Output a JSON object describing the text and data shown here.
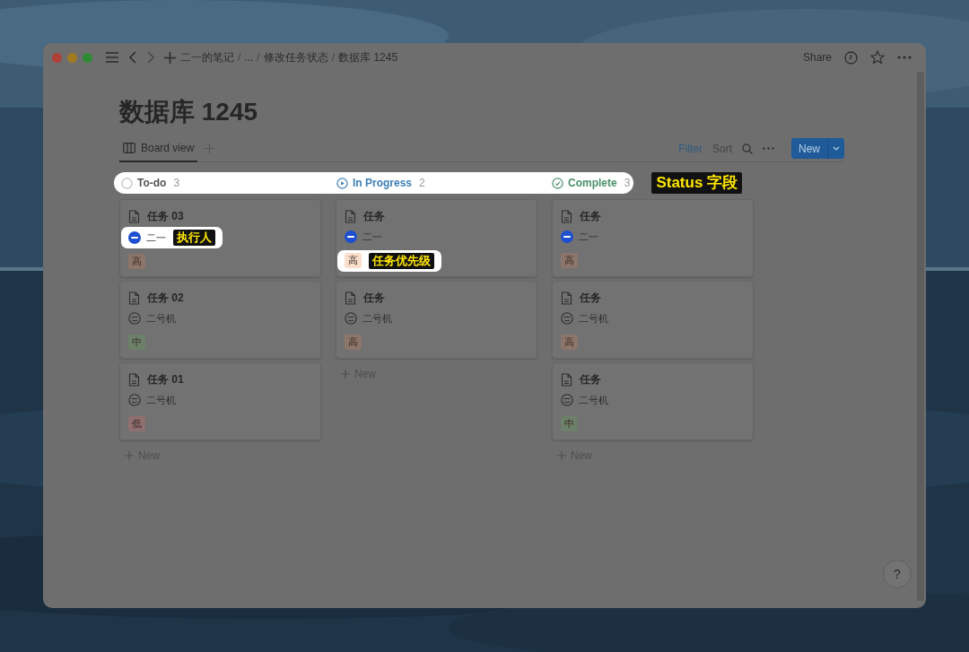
{
  "window": {
    "breadcrumbs": [
      "二一的笔记",
      "...",
      "修改任务状态",
      "数据库 1245"
    ],
    "separator": "/",
    "share": "Share",
    "help": "?"
  },
  "title": "数据库 1245",
  "views": [
    {
      "label": "Board view",
      "selected": true
    }
  ],
  "toolbar": {
    "filter": "Filter",
    "sort": "Sort",
    "new_button": "New"
  },
  "status_bar": {
    "highlighted": true,
    "annotation": "Status 字段"
  },
  "columns": [
    {
      "kind": "todo",
      "label": "To-do",
      "count": "3",
      "new_label": "New",
      "cards": [
        {
          "title": "任务 03",
          "assignee": {
            "kind": "avatar",
            "name": "二一",
            "highlighted": true,
            "annotation": "执行人"
          },
          "priority": {
            "label": "高",
            "color": "#8c766b",
            "highlighted": false
          }
        },
        {
          "title": "任务 02",
          "assignee": {
            "kind": "face",
            "name": "二号机",
            "highlighted": false
          },
          "priority": {
            "label": "中",
            "color": "#6d8069",
            "highlighted": false
          }
        },
        {
          "title": "任务 01",
          "assignee": {
            "kind": "face",
            "name": "二号机",
            "highlighted": false
          },
          "priority": {
            "label": "低",
            "color": "#8f6f6f",
            "highlighted": false
          }
        }
      ]
    },
    {
      "kind": "in_progress",
      "label": "In Progress",
      "count": "2",
      "new_label": "New",
      "cards": [
        {
          "title": "任务",
          "assignee": {
            "kind": "avatar",
            "name": "二一",
            "highlighted": false
          },
          "priority": {
            "label": "高",
            "color": "#fbdfcc",
            "highlighted": true,
            "annotation": "任务优先级"
          }
        },
        {
          "title": "任务",
          "assignee": {
            "kind": "face",
            "name": "二号机",
            "highlighted": false
          },
          "priority": {
            "label": "高",
            "color": "#8c766b",
            "highlighted": false
          }
        }
      ]
    },
    {
      "kind": "complete",
      "label": "Complete",
      "count": "3",
      "new_label": "New",
      "cards": [
        {
          "title": "任务",
          "assignee": {
            "kind": "avatar",
            "name": "二一",
            "highlighted": false
          },
          "priority": {
            "label": "高",
            "color": "#8c766b",
            "highlighted": false
          }
        },
        {
          "title": "任务",
          "assignee": {
            "kind": "face",
            "name": "二号机",
            "highlighted": false
          },
          "priority": {
            "label": "高",
            "color": "#8c766b",
            "highlighted": false
          }
        },
        {
          "title": "任务",
          "assignee": {
            "kind": "face",
            "name": "二号机",
            "highlighted": false
          },
          "priority": {
            "label": "中",
            "color": "#6d8069",
            "highlighted": false
          }
        }
      ]
    }
  ]
}
